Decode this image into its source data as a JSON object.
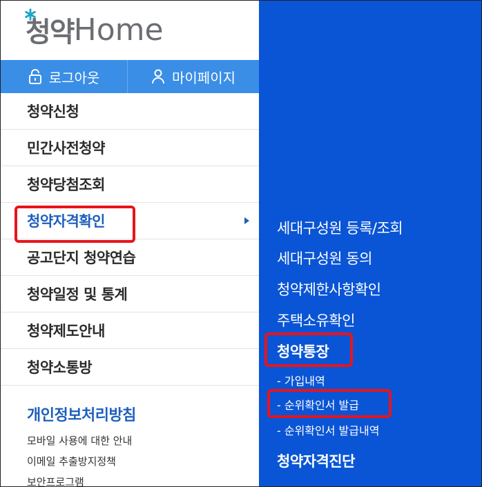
{
  "logo": {
    "korean": "청약",
    "english": "Home"
  },
  "topbar": {
    "logout": "로그아웃",
    "mypage": "마이페이지"
  },
  "menu": [
    {
      "label": "청약신청"
    },
    {
      "label": "민간사전청약"
    },
    {
      "label": "청약당첨조회"
    },
    {
      "label": "청약자격확인"
    },
    {
      "label": "공고단지 청약연습"
    },
    {
      "label": "청약일정 및 통계"
    },
    {
      "label": "청약제도안내"
    },
    {
      "label": "청약소통방"
    }
  ],
  "footer": {
    "privacy": "개인정보처리방침",
    "links": [
      "모바일 사용에 대한 안내",
      "이메일 추출방지정책",
      "보안프로그램"
    ]
  },
  "submenu": {
    "items": [
      "세대구성원 등록/조회",
      "세대구성원 동의",
      "청약제한사항확인",
      "주택소유확인"
    ],
    "group_title": "청약통장",
    "group_items": [
      "- 가입내역",
      "- 순위확인서 발급",
      "- 순위확인서 발급내역"
    ],
    "last": "청약자격진단"
  },
  "colors": {
    "accent": "#3a8ee6",
    "submenu_bg": "#0a55d6",
    "highlight": "#e8141b",
    "active_text": "#1d5fbf"
  }
}
